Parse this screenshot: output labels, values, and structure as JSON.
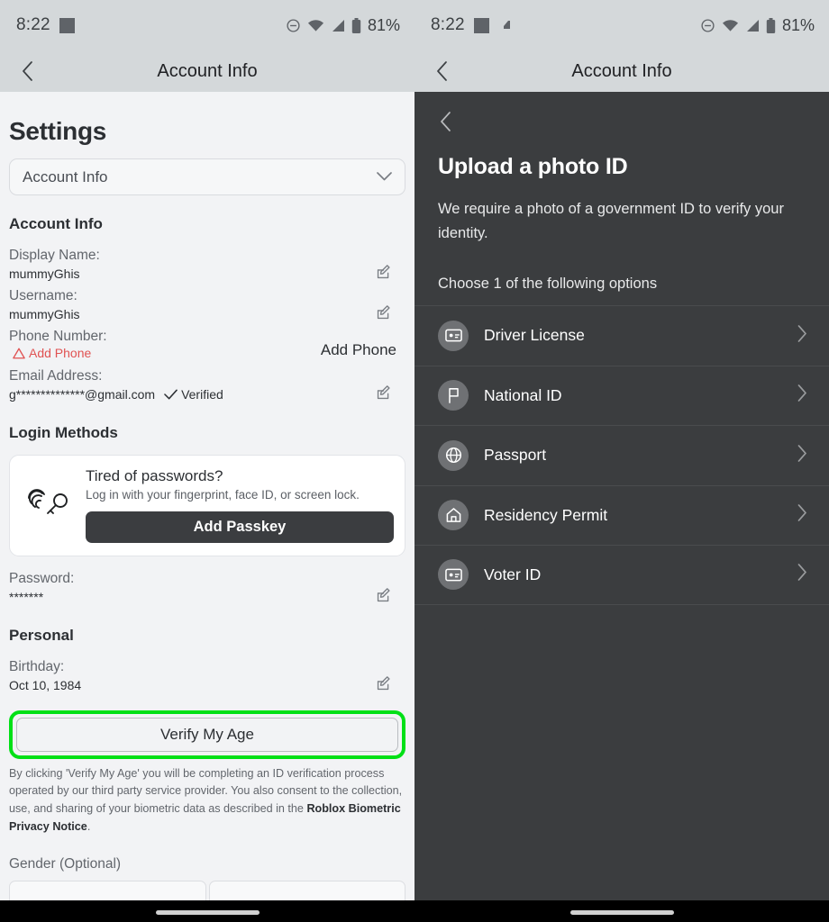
{
  "statusbar": {
    "time": "8:22",
    "battery_pct": "81%",
    "icons": [
      "screen-record-icon",
      "do-not-disturb-icon",
      "wifi-icon",
      "cellular-signal-icon",
      "battery-icon"
    ],
    "right_extra_icon": "cast-icon"
  },
  "titlebar": {
    "title": "Account Info",
    "back": "back-chevron"
  },
  "left": {
    "heading": "Settings",
    "dropdown": {
      "value": "Account Info"
    },
    "section_account": "Account Info",
    "fields": [
      {
        "label": "Display Name:",
        "value": "mummyGhis"
      },
      {
        "label": "Username:",
        "value": "mummyGhis"
      }
    ],
    "phone": {
      "label": "Phone Number:",
      "warning": "Add Phone",
      "action": "Add Phone"
    },
    "email": {
      "label": "Email Address:",
      "value": "g**************@gmail.com",
      "verified": "Verified"
    },
    "section_login": "Login Methods",
    "passkey": {
      "title": "Tired of passwords?",
      "subtitle": "Log in with your fingerprint, face ID, or screen lock.",
      "button": "Add Passkey"
    },
    "password": {
      "label": "Password:",
      "value": "*******"
    },
    "section_personal": "Personal",
    "birthday": {
      "label": "Birthday:",
      "value": "Oct 10, 1984"
    },
    "verify_button": "Verify My Age",
    "legal_text_1": "By clicking 'Verify My Age' you will be completing an ID verification process operated by our third party service provider. You also consent to the collection, use, and sharing of your biometric data as described in the ",
    "legal_bold": "Roblox Biometric Privacy Notice",
    "legal_text_2": ".",
    "gender_label": "Gender (Optional)",
    "highlight_color": "#00e016"
  },
  "right": {
    "title": "Upload a photo ID",
    "description": "We require a photo of a government ID to verify your identity.",
    "choose_label": "Choose 1 of the following options",
    "options": [
      {
        "label": "Driver License",
        "icon": "id-card-icon"
      },
      {
        "label": "National ID",
        "icon": "flag-icon"
      },
      {
        "label": "Passport",
        "icon": "globe-icon"
      },
      {
        "label": "Residency Permit",
        "icon": "home-icon"
      },
      {
        "label": "Voter ID",
        "icon": "id-card-icon"
      }
    ],
    "background_color": "#3b3d3f"
  }
}
